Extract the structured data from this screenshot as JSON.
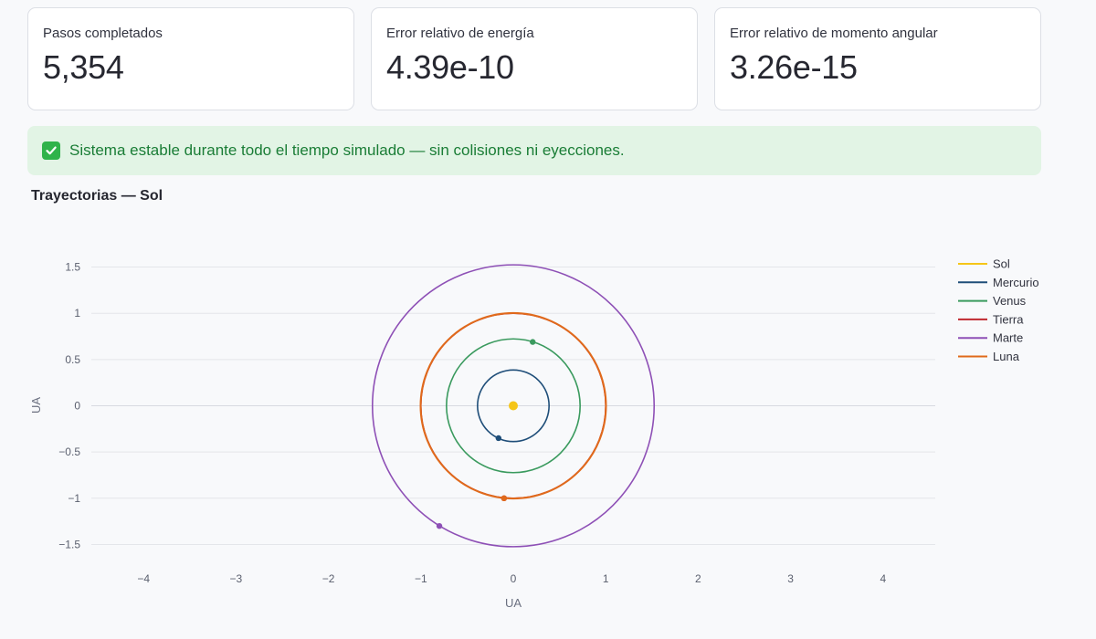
{
  "metrics": [
    {
      "label": "Pasos completados",
      "value": "5,354"
    },
    {
      "label": "Error relativo de energía",
      "value": "4.39e-10"
    },
    {
      "label": "Error relativo de momento angular",
      "value": "3.26e-15"
    }
  ],
  "alert": {
    "icon": "check-icon",
    "text": "Sistema estable durante todo el tiempo simulado — sin colisiones ni eyecciones.",
    "color": "#1a7d36"
  },
  "chart_title": "Trayectorias — Sol",
  "chart_data": {
    "type": "line",
    "xlabel": "UA",
    "ylabel": "UA",
    "xlim": [
      -4.6,
      4.6
    ],
    "ylim": [
      -1.85,
      1.85
    ],
    "x_ticks": [
      -4,
      -3,
      -2,
      -1,
      0,
      1,
      2,
      3,
      4
    ],
    "y_ticks": [
      -1.5,
      -1,
      -0.5,
      0,
      0.5,
      1,
      1.5
    ],
    "x_tick_labels": [
      "−4",
      "−3",
      "−2",
      "−1",
      "0",
      "1",
      "2",
      "3",
      "4"
    ],
    "y_tick_labels": [
      "−1.5",
      "−1",
      "−0.5",
      "0",
      "0.5",
      "1",
      "1.5"
    ],
    "grid": true,
    "legend_position": "top-right",
    "series": [
      {
        "name": "Sol",
        "color": "#f5c518",
        "radius": 0.0,
        "current": [
          0,
          0
        ]
      },
      {
        "name": "Mercurio",
        "color": "#1f4e79",
        "radius": 0.387,
        "current": [
          -0.16,
          -0.35
        ]
      },
      {
        "name": "Venus",
        "color": "#3a9a5e",
        "radius": 0.723,
        "current": [
          0.21,
          0.69
        ]
      },
      {
        "name": "Tierra",
        "color": "#c0282e",
        "radius": 1.0,
        "current": [
          -0.1,
          -1.0
        ]
      },
      {
        "name": "Marte",
        "color": "#8e50b6",
        "radius": 1.524,
        "current": [
          -0.8,
          -1.3
        ]
      },
      {
        "name": "Luna",
        "color": "#e06a1b",
        "radius": 1.003,
        "current": [
          -0.1,
          -1.0
        ]
      }
    ]
  }
}
